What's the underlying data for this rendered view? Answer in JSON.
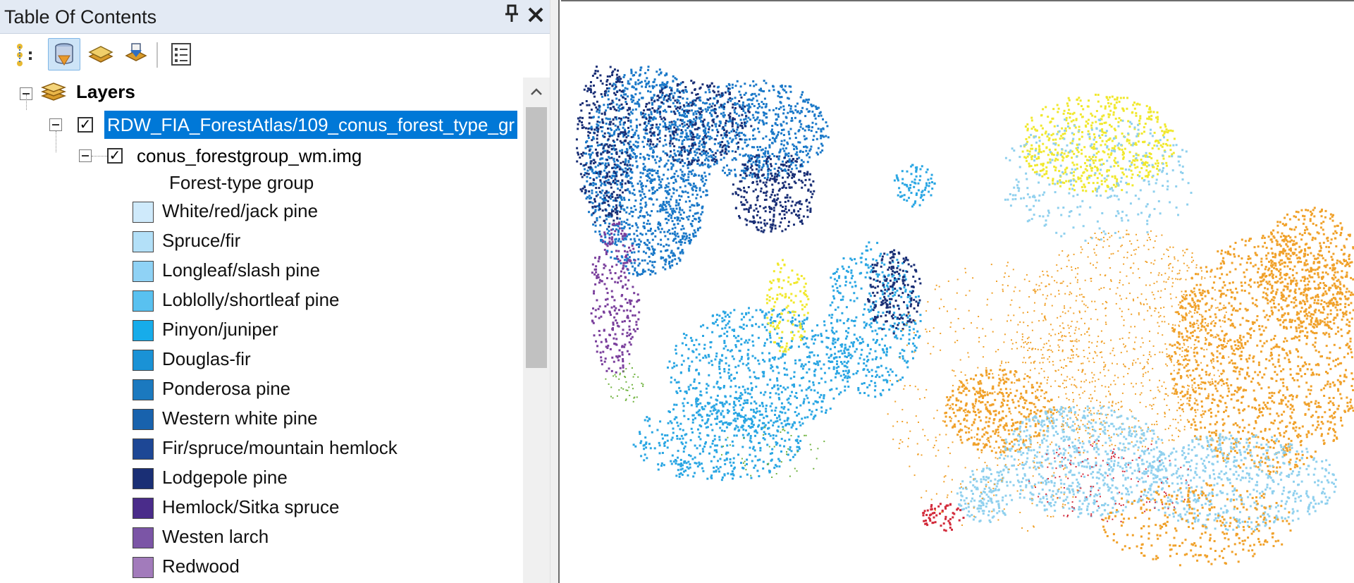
{
  "toc": {
    "title": "Table Of Contents",
    "pin_icon": "pin-icon",
    "close_icon": "close-icon",
    "toolbar": {
      "buttons": [
        "list-by-drawing-order-icon",
        "list-by-source-icon",
        "list-by-visibility-icon",
        "list-by-selection-icon",
        "options-icon"
      ],
      "active_button": "list-by-source-icon"
    },
    "tree": {
      "root_label": "Layers",
      "service_label": "RDW_FIA_ForestAtlas/109_conus_forest_type_gr",
      "raster_label": "conus_forestgroup_wm.img",
      "legend_heading": "Forest-type group",
      "legend_items": [
        {
          "label": "White/red/jack pine",
          "color": "#cfeafb"
        },
        {
          "label": "Spruce/fir",
          "color": "#b3e0f8"
        },
        {
          "label": "Longleaf/slash pine",
          "color": "#8fd2f5"
        },
        {
          "label": "Loblolly/shortleaf pine",
          "color": "#59c1f0"
        },
        {
          "label": "Pinyon/juniper",
          "color": "#17acea"
        },
        {
          "label": "Douglas-fir",
          "color": "#1a92d6"
        },
        {
          "label": "Ponderosa pine",
          "color": "#1b79bf"
        },
        {
          "label": "Western white pine",
          "color": "#1862ad"
        },
        {
          "label": "Fir/spruce/mountain hemlock",
          "color": "#1d4795"
        },
        {
          "label": "Lodgepole pine",
          "color": "#1a2f75"
        },
        {
          "label": "Hemlock/Sitka spruce",
          "color": "#4a2c8a"
        },
        {
          "label": "Westen larch",
          "color": "#7b55a6"
        },
        {
          "label": "Redwood",
          "color": "#a27bbb"
        }
      ]
    }
  },
  "map": {
    "colors": {
      "west_blue": "#1a78c8",
      "dark_navy": "#1a2f75",
      "sky": "#2aa6e3",
      "light_blue": "#8fd0ee",
      "purple": "#7a3f9c",
      "yellow": "#f1e82d",
      "orange": "#f0a12a",
      "red": "#d22a3a",
      "green": "#6fb23e"
    }
  }
}
